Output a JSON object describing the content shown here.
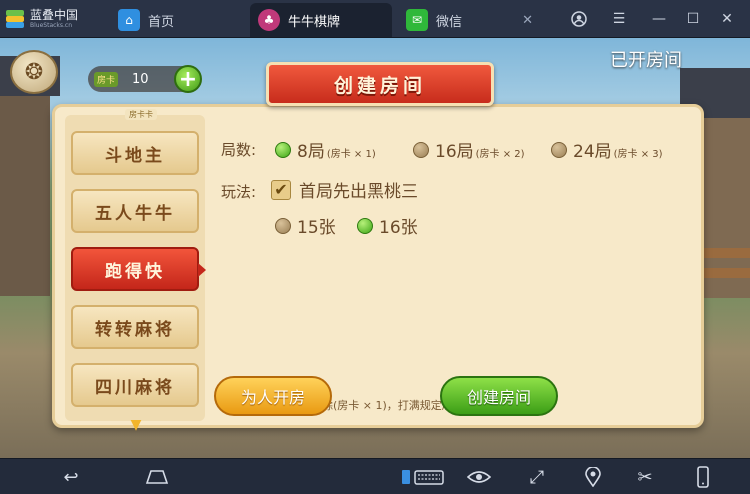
{
  "titlebar": {
    "brand_name": "蓝叠中国",
    "brand_sub": "BlueStacks.cn",
    "tabs": [
      {
        "label": "首页",
        "icon": "home-icon"
      },
      {
        "label": "牛牛棋牌",
        "icon": "game-app-icon"
      },
      {
        "label": "微信",
        "icon": "wechat-icon"
      }
    ],
    "window_controls": [
      "account-icon",
      "menu-icon",
      "minimize-icon",
      "maximize-icon",
      "close-icon"
    ]
  },
  "game": {
    "room_card_badge": "房卡",
    "room_card_count": "10",
    "opened_rooms_label": "已开房间",
    "dialog_title": "创建房间",
    "sidebar_tag": "房卡卡",
    "modes": [
      "斗地主",
      "五人牛牛",
      "跑得快",
      "转转麻将",
      "四川麻将"
    ],
    "active_mode_index": 2,
    "rounds": {
      "label": "局数:",
      "options": [
        {
          "label": "8局",
          "cost": "(房卡 × 1)",
          "selected": true
        },
        {
          "label": "16局",
          "cost": "(房卡 × 2)",
          "selected": false
        },
        {
          "label": "24局",
          "cost": "(房卡 × 3)",
          "selected": false
        }
      ]
    },
    "play": {
      "label": "玩法:",
      "checkbox_label": "首局先出黑桃三",
      "checkbox_checked": true,
      "cards": [
        {
          "label": "15张",
          "selected": false
        },
        {
          "label": "16张",
          "selected": true
        }
      ]
    },
    "note": "首局游戏开始立即扣除(房卡 × 1)，打满规定局数后...",
    "buttons": {
      "open_for_others": "为人开房",
      "create_room": "创建房间"
    }
  },
  "bottombar": {
    "icons": [
      "back-icon",
      "home-nav-icon",
      "keyboard-icon",
      "eye-icon",
      "fullscreen-icon",
      "location-icon",
      "scissors-icon",
      "phone-rotate-icon"
    ]
  },
  "colors": {
    "titlebar": "#2a3346",
    "ribbon": "#d8392a",
    "panel": "#f7e9c9",
    "accent_green": "#3ea616",
    "accent_orange": "#e99a12"
  }
}
